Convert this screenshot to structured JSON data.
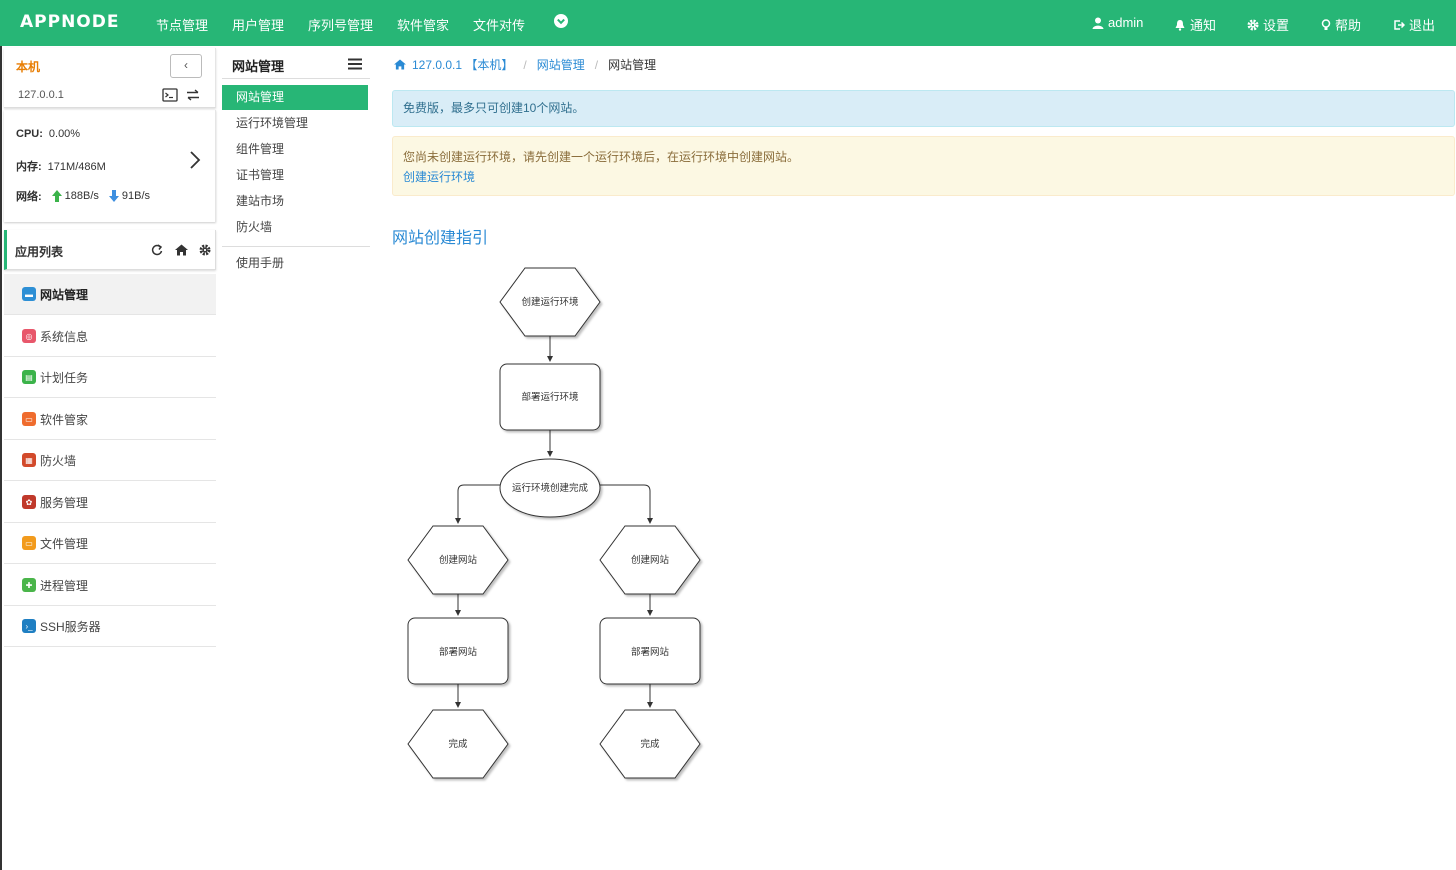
{
  "topbar": {
    "logo": "APPNODE",
    "nav": [
      "节点管理",
      "用户管理",
      "序列号管理",
      "软件管家",
      "文件对传"
    ],
    "user": "admin",
    "notify": "通知",
    "settings": "设置",
    "help": "帮助",
    "logout": "退出",
    "bg_color": "#27b676"
  },
  "host": {
    "name": "本机",
    "ip": "127.0.0.1",
    "cpu_label": "CPU:",
    "cpu": "0.00%",
    "mem_label": "内存:",
    "mem": "171M/486M",
    "net_label": "网络:",
    "net_up": "188B/s",
    "net_down": "91B/s"
  },
  "applist": {
    "title": "应用列表",
    "items": [
      "网站管理",
      "系统信息",
      "计划任务",
      "软件管家",
      "防火墙",
      "服务管理",
      "文件管理",
      "进程管理",
      "SSH服务器"
    ],
    "icon_colors": [
      "#2d8fd5",
      "#e8576b",
      "#3bb34a",
      "#ef6c2e",
      "#d24a2b",
      "#d24a2b",
      "#f29b1d",
      "#4ab54a",
      "#1f7fc2"
    ]
  },
  "submenu": {
    "title": "网站管理",
    "items": [
      "网站管理",
      "运行环境管理",
      "组件管理",
      "证书管理",
      "建站市场",
      "防火墙"
    ],
    "extra": "使用手册"
  },
  "breadcrumb": {
    "host": "127.0.0.1 【本机】",
    "section": "网站管理",
    "current": "网站管理"
  },
  "alerts": {
    "info": "免费版，最多只可创建10个网站。",
    "warn": "您尚未创建运行环境，请先创建一个运行环境后，在运行环境中创建网站。",
    "warn_link": "创建运行环境"
  },
  "guide": {
    "title": "网站创建指引",
    "nodes": {
      "n1": "创建运行环境",
      "n2": "部署运行环境",
      "n3": "运行环境创建完成",
      "l1": "创建网站",
      "l2": "部署网站",
      "l3": "完成",
      "r1": "创建网站",
      "r2": "部署网站",
      "r3": "完成"
    }
  }
}
